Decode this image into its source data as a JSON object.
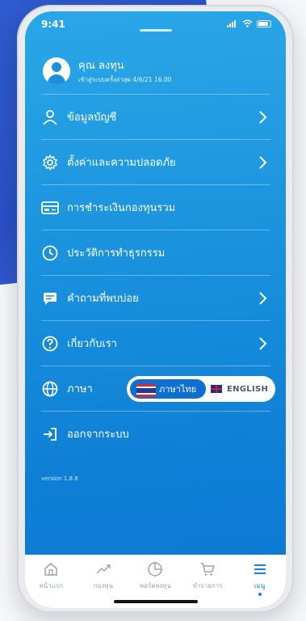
{
  "status_bar": {
    "time": "9:41"
  },
  "profile": {
    "name": "คุณ ลงทุน",
    "last_login": "เข้าสู่ระบบครั้งล่าสุด 4/6/21 16.00"
  },
  "menu": {
    "items": [
      {
        "label": "ข้อมูลบัญชี",
        "icon": "user-icon",
        "chevron": true
      },
      {
        "label": "ตั้งค่าและความปลอดภัย",
        "icon": "gear-icon",
        "chevron": true
      },
      {
        "label": "การชำระเงินกองทุนรวม",
        "icon": "card-icon",
        "chevron": false
      },
      {
        "label": "ประวัติการทำธุรกรรม",
        "icon": "clock-icon",
        "chevron": false
      },
      {
        "label": "คำถามที่พบบ่อย",
        "icon": "chat-icon",
        "chevron": true
      },
      {
        "label": "เกี่ยวกับเรา",
        "icon": "help-icon",
        "chevron": true
      },
      {
        "label": "ภาษา",
        "icon": "globe-icon"
      },
      {
        "label": "ออกจากระบบ",
        "icon": "logout-icon"
      }
    ]
  },
  "language": {
    "thai": "ภาษาไทย",
    "english": "ENGLISH",
    "selected": "thai"
  },
  "version": "version 1.8.8",
  "tabbar": {
    "items": [
      {
        "label": "หน้าแรก",
        "icon": "home-icon"
      },
      {
        "label": "กองทุน",
        "icon": "trend-icon"
      },
      {
        "label": "พอร์ตลงทุน",
        "icon": "pie-icon"
      },
      {
        "label": "ทำรายการ",
        "icon": "cart-icon"
      },
      {
        "label": "เมนู",
        "icon": "menu-icon",
        "active": true
      }
    ]
  },
  "colors": {
    "accent": "#1a7fe0",
    "screen_top": "#2aa7e8",
    "screen_bottom": "#0c78d2"
  }
}
